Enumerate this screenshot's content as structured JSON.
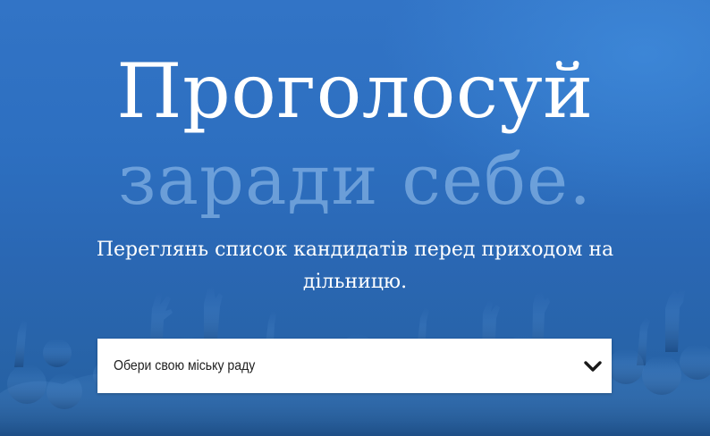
{
  "hero": {
    "title": "Проголосуй",
    "subtitle": "заради себе.",
    "lead": "Переглянь список кандидатів перед приходом на дільницю."
  },
  "city_select": {
    "selected_label": "Обери свою міську раду",
    "icon": "chevron-down-icon"
  },
  "colors": {
    "background": "#2d6fc0",
    "title": "#ffffff",
    "subtitle": "#7fb0e6",
    "select_background": "#ffffff",
    "select_text": "#1f1f1f"
  }
}
